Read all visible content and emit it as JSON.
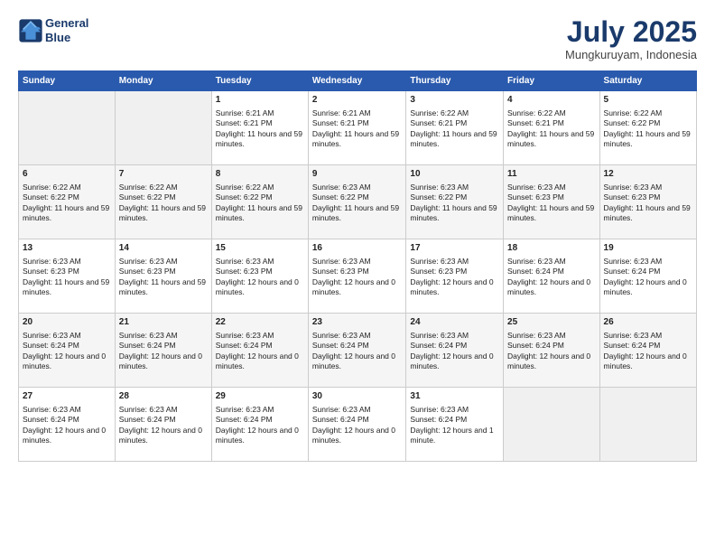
{
  "logo": {
    "line1": "General",
    "line2": "Blue"
  },
  "title": "July 2025",
  "subtitle": "Mungkuruyam, Indonesia",
  "days_header": [
    "Sunday",
    "Monday",
    "Tuesday",
    "Wednesday",
    "Thursday",
    "Friday",
    "Saturday"
  ],
  "weeks": [
    [
      {
        "day": "",
        "info": ""
      },
      {
        "day": "",
        "info": ""
      },
      {
        "day": "1",
        "info": "Sunrise: 6:21 AM\nSunset: 6:21 PM\nDaylight: 11 hours and 59 minutes."
      },
      {
        "day": "2",
        "info": "Sunrise: 6:21 AM\nSunset: 6:21 PM\nDaylight: 11 hours and 59 minutes."
      },
      {
        "day": "3",
        "info": "Sunrise: 6:22 AM\nSunset: 6:21 PM\nDaylight: 11 hours and 59 minutes."
      },
      {
        "day": "4",
        "info": "Sunrise: 6:22 AM\nSunset: 6:21 PM\nDaylight: 11 hours and 59 minutes."
      },
      {
        "day": "5",
        "info": "Sunrise: 6:22 AM\nSunset: 6:22 PM\nDaylight: 11 hours and 59 minutes."
      }
    ],
    [
      {
        "day": "6",
        "info": "Sunrise: 6:22 AM\nSunset: 6:22 PM\nDaylight: 11 hours and 59 minutes."
      },
      {
        "day": "7",
        "info": "Sunrise: 6:22 AM\nSunset: 6:22 PM\nDaylight: 11 hours and 59 minutes."
      },
      {
        "day": "8",
        "info": "Sunrise: 6:22 AM\nSunset: 6:22 PM\nDaylight: 11 hours and 59 minutes."
      },
      {
        "day": "9",
        "info": "Sunrise: 6:23 AM\nSunset: 6:22 PM\nDaylight: 11 hours and 59 minutes."
      },
      {
        "day": "10",
        "info": "Sunrise: 6:23 AM\nSunset: 6:22 PM\nDaylight: 11 hours and 59 minutes."
      },
      {
        "day": "11",
        "info": "Sunrise: 6:23 AM\nSunset: 6:23 PM\nDaylight: 11 hours and 59 minutes."
      },
      {
        "day": "12",
        "info": "Sunrise: 6:23 AM\nSunset: 6:23 PM\nDaylight: 11 hours and 59 minutes."
      }
    ],
    [
      {
        "day": "13",
        "info": "Sunrise: 6:23 AM\nSunset: 6:23 PM\nDaylight: 11 hours and 59 minutes."
      },
      {
        "day": "14",
        "info": "Sunrise: 6:23 AM\nSunset: 6:23 PM\nDaylight: 11 hours and 59 minutes."
      },
      {
        "day": "15",
        "info": "Sunrise: 6:23 AM\nSunset: 6:23 PM\nDaylight: 12 hours and 0 minutes."
      },
      {
        "day": "16",
        "info": "Sunrise: 6:23 AM\nSunset: 6:23 PM\nDaylight: 12 hours and 0 minutes."
      },
      {
        "day": "17",
        "info": "Sunrise: 6:23 AM\nSunset: 6:23 PM\nDaylight: 12 hours and 0 minutes."
      },
      {
        "day": "18",
        "info": "Sunrise: 6:23 AM\nSunset: 6:24 PM\nDaylight: 12 hours and 0 minutes."
      },
      {
        "day": "19",
        "info": "Sunrise: 6:23 AM\nSunset: 6:24 PM\nDaylight: 12 hours and 0 minutes."
      }
    ],
    [
      {
        "day": "20",
        "info": "Sunrise: 6:23 AM\nSunset: 6:24 PM\nDaylight: 12 hours and 0 minutes."
      },
      {
        "day": "21",
        "info": "Sunrise: 6:23 AM\nSunset: 6:24 PM\nDaylight: 12 hours and 0 minutes."
      },
      {
        "day": "22",
        "info": "Sunrise: 6:23 AM\nSunset: 6:24 PM\nDaylight: 12 hours and 0 minutes."
      },
      {
        "day": "23",
        "info": "Sunrise: 6:23 AM\nSunset: 6:24 PM\nDaylight: 12 hours and 0 minutes."
      },
      {
        "day": "24",
        "info": "Sunrise: 6:23 AM\nSunset: 6:24 PM\nDaylight: 12 hours and 0 minutes."
      },
      {
        "day": "25",
        "info": "Sunrise: 6:23 AM\nSunset: 6:24 PM\nDaylight: 12 hours and 0 minutes."
      },
      {
        "day": "26",
        "info": "Sunrise: 6:23 AM\nSunset: 6:24 PM\nDaylight: 12 hours and 0 minutes."
      }
    ],
    [
      {
        "day": "27",
        "info": "Sunrise: 6:23 AM\nSunset: 6:24 PM\nDaylight: 12 hours and 0 minutes."
      },
      {
        "day": "28",
        "info": "Sunrise: 6:23 AM\nSunset: 6:24 PM\nDaylight: 12 hours and 0 minutes."
      },
      {
        "day": "29",
        "info": "Sunrise: 6:23 AM\nSunset: 6:24 PM\nDaylight: 12 hours and 0 minutes."
      },
      {
        "day": "30",
        "info": "Sunrise: 6:23 AM\nSunset: 6:24 PM\nDaylight: 12 hours and 0 minutes."
      },
      {
        "day": "31",
        "info": "Sunrise: 6:23 AM\nSunset: 6:24 PM\nDaylight: 12 hours and 1 minute."
      },
      {
        "day": "",
        "info": ""
      },
      {
        "day": "",
        "info": ""
      }
    ]
  ]
}
